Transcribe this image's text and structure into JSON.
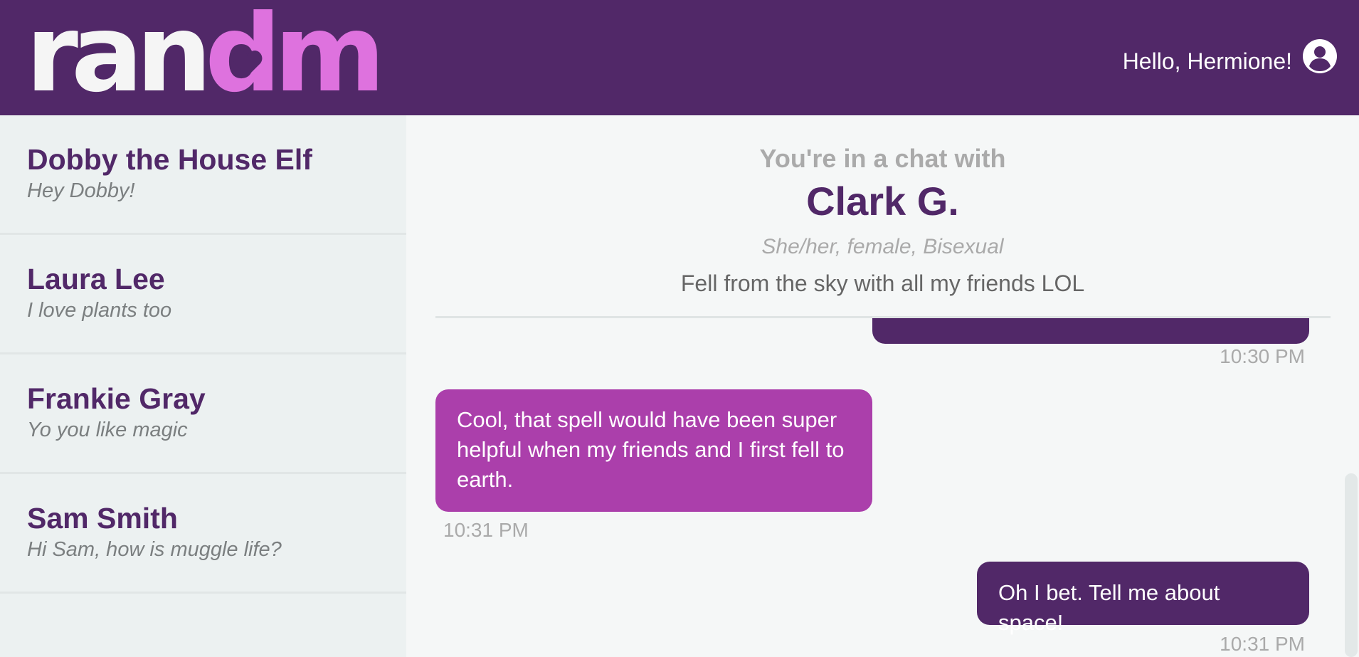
{
  "header": {
    "logo": {
      "part1": "ran",
      "part2": "dm",
      "full": "randm"
    },
    "greeting": "Hello, Hermione!",
    "user_icon": "user-circle-icon"
  },
  "sidebar": {
    "chats": [
      {
        "name": "Dobby the House Elf",
        "preview": "Hey Dobby!"
      },
      {
        "name": "Laura Lee",
        "preview": "I love plants too"
      },
      {
        "name": "Frankie Gray",
        "preview": "Yo you like magic"
      },
      {
        "name": "Sam Smith",
        "preview": "Hi Sam, how is muggle life?"
      }
    ]
  },
  "chat": {
    "intro": "You're in a chat with",
    "partner_name": "Clark G.",
    "partner_meta": "She/her, female, Bisexual",
    "partner_bio": "Fell from the sky with all my friends LOL",
    "messages": [
      {
        "from": "me",
        "text": "",
        "time": "10:30 PM"
      },
      {
        "from": "them",
        "text": "Cool, that spell would have been super helpful when my friends and I first fell to earth.",
        "time": "10:31 PM"
      },
      {
        "from": "me",
        "text": "Oh I bet. Tell me about space!",
        "time": "10:31 PM"
      }
    ]
  },
  "colors": {
    "brand_purple": "#512868",
    "brand_pink": "#de72de",
    "received_bubble": "#ab3fab",
    "sidebar_bg": "#ecf1f1",
    "main_bg": "#f5f7f7"
  }
}
